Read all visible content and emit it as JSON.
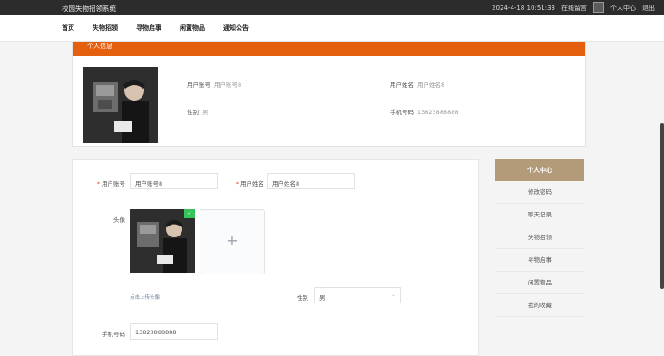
{
  "topbar": {
    "site_title": "校园失物招领系统",
    "datetime": "2024-4-18 10:51:33",
    "online_msg": "在线留言",
    "user_center": "个人中心",
    "logout": "退出"
  },
  "nav": {
    "items": [
      "首页",
      "失物招领",
      "寻物启事",
      "闲置物品",
      "通知公告"
    ]
  },
  "profile": {
    "header": "个人信息",
    "account_label": "用户账号",
    "account_value": "用户账号8",
    "name_label": "用户姓名",
    "name_value": "用户姓名8",
    "gender_label": "性别",
    "gender_value": "男",
    "phone_label": "手机号码",
    "phone_value": "13823888888"
  },
  "form": {
    "account_label": "用户账号",
    "account_value": "用户账号8",
    "name_label": "用户姓名",
    "name_value": "用户姓名8",
    "avatar_label": "头像",
    "upload_plus": "+",
    "upload_hint": "点击上传头像",
    "gender_label": "性别",
    "gender_value": "男",
    "phone_label": "手机号码",
    "phone_value": "13823888888",
    "required_mark": "*",
    "check_mark": "✓",
    "chevron": "⌄"
  },
  "sidebar": {
    "title": "个人中心",
    "items": [
      "修改密码",
      "聊天记录",
      "失物招领",
      "寻物启事",
      "闲置物品",
      "我的收藏"
    ]
  }
}
